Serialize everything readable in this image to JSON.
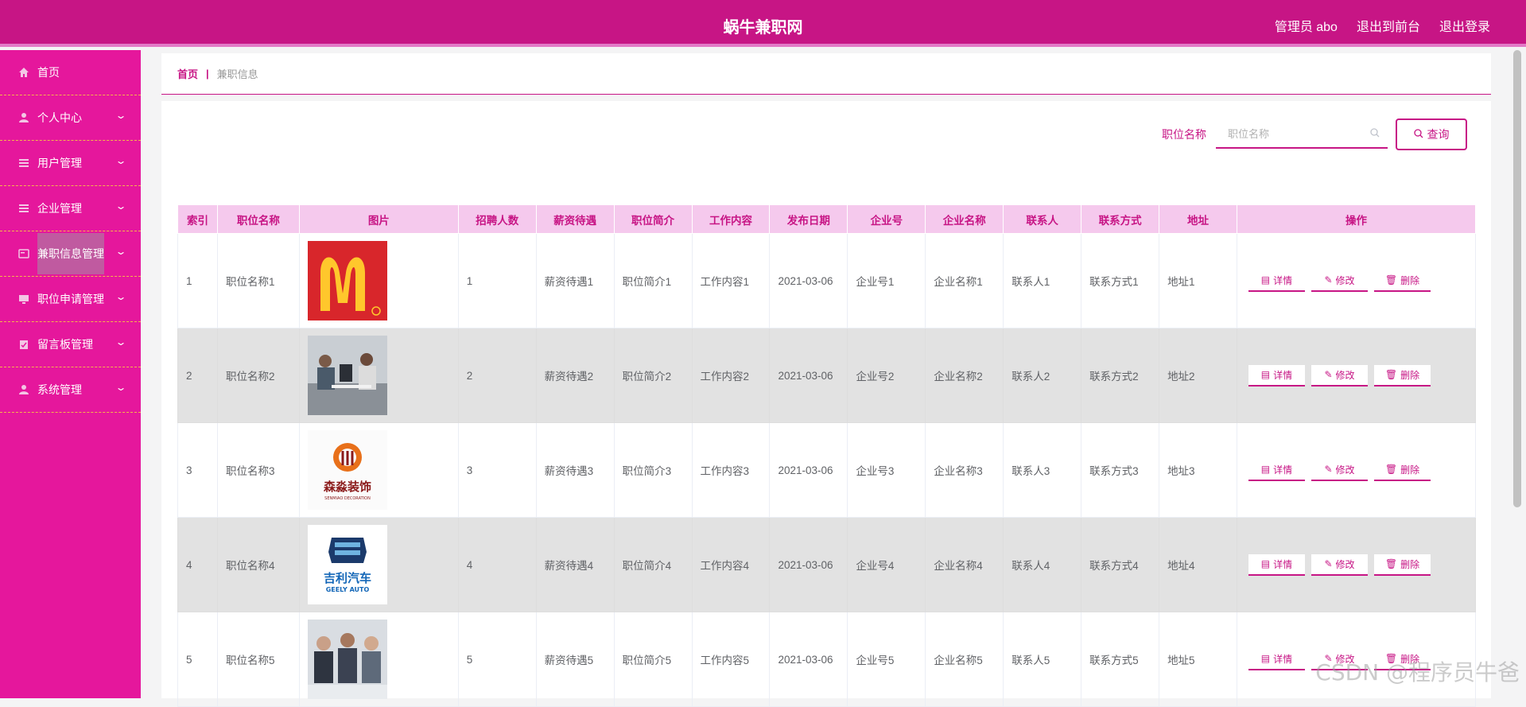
{
  "app": {
    "title": "蜗牛兼职网"
  },
  "top_links": [
    "管理员 abo",
    "退出到前台",
    "退出登录"
  ],
  "sidebar": {
    "items": [
      {
        "label": "首页",
        "icon": "home-icon",
        "chevron": false
      },
      {
        "label": "个人中心",
        "icon": "user-icon",
        "chevron": true
      },
      {
        "label": "用户管理",
        "icon": "list-icon",
        "chevron": true
      },
      {
        "label": "企业管理",
        "icon": "list-icon",
        "chevron": true
      },
      {
        "label": "兼职信息管理",
        "icon": "card-icon",
        "chevron": true,
        "active": true
      },
      {
        "label": "职位申请管理",
        "icon": "monitor-icon",
        "chevron": true
      },
      {
        "label": "留言板管理",
        "icon": "clipboard-icon",
        "chevron": true
      },
      {
        "label": "系统管理",
        "icon": "user-icon",
        "chevron": true
      }
    ]
  },
  "breadcrumb": {
    "home": "首页",
    "separator": "|",
    "current": "兼职信息"
  },
  "search": {
    "label": "职位名称",
    "placeholder": "职位名称",
    "value": "",
    "button": "查询"
  },
  "table": {
    "headers": [
      "索引",
      "职位名称",
      "图片",
      "招聘人数",
      "薪资待遇",
      "职位简介",
      "工作内容",
      "发布日期",
      "企业号",
      "企业名称",
      "联系人",
      "联系方式",
      "地址",
      "操作"
    ],
    "rows": [
      {
        "index": "1",
        "name": "职位名称1",
        "image": "mcdonalds-logo",
        "count": "1",
        "salary": "薪资待遇1",
        "intro": "职位简介1",
        "content": "工作内容1",
        "date": "2021-03-06",
        "corp_no": "企业号1",
        "corp_name": "企业名称1",
        "contact": "联系人1",
        "phone": "联系方式1",
        "address": "地址1"
      },
      {
        "index": "2",
        "name": "职位名称2",
        "image": "office-meeting-photo",
        "count": "2",
        "salary": "薪资待遇2",
        "intro": "职位简介2",
        "content": "工作内容2",
        "date": "2021-03-06",
        "corp_no": "企业号2",
        "corp_name": "企业名称2",
        "contact": "联系人2",
        "phone": "联系方式2",
        "address": "地址2"
      },
      {
        "index": "3",
        "name": "职位名称3",
        "image": "senmiao-decoration-logo",
        "count": "3",
        "salary": "薪资待遇3",
        "intro": "职位简介3",
        "content": "工作内容3",
        "date": "2021-03-06",
        "corp_no": "企业号3",
        "corp_name": "企业名称3",
        "contact": "联系人3",
        "phone": "联系方式3",
        "address": "地址3"
      },
      {
        "index": "4",
        "name": "职位名称4",
        "image": "geely-auto-logo",
        "count": "4",
        "salary": "薪资待遇4",
        "intro": "职位简介4",
        "content": "工作内容4",
        "date": "2021-03-06",
        "corp_no": "企业号4",
        "corp_name": "企业名称4",
        "contact": "联系人4",
        "phone": "联系方式4",
        "address": "地址4"
      },
      {
        "index": "5",
        "name": "职位名称5",
        "image": "business-team-photo",
        "count": "5",
        "salary": "薪资待遇5",
        "intro": "职位简介5",
        "content": "工作内容5",
        "date": "2021-03-06",
        "corp_no": "企业号5",
        "corp_name": "企业名称5",
        "contact": "联系人5",
        "phone": "联系方式5",
        "address": "地址5"
      }
    ],
    "actions": [
      "详情",
      "修改",
      "删除"
    ]
  },
  "logo_text": {
    "senmiao": "森淼装饰",
    "senmiao_en": "SENMIAO DECORATION",
    "geely": "吉利汽车",
    "geely_en": "GEELY AUTO"
  },
  "watermark": "CSDN @程序员牛爸",
  "colors": {
    "brand": "#c71585",
    "sidebar": "#e5179c",
    "header_row": "#f5c9ed",
    "alt_row": "#e2e2e2"
  }
}
